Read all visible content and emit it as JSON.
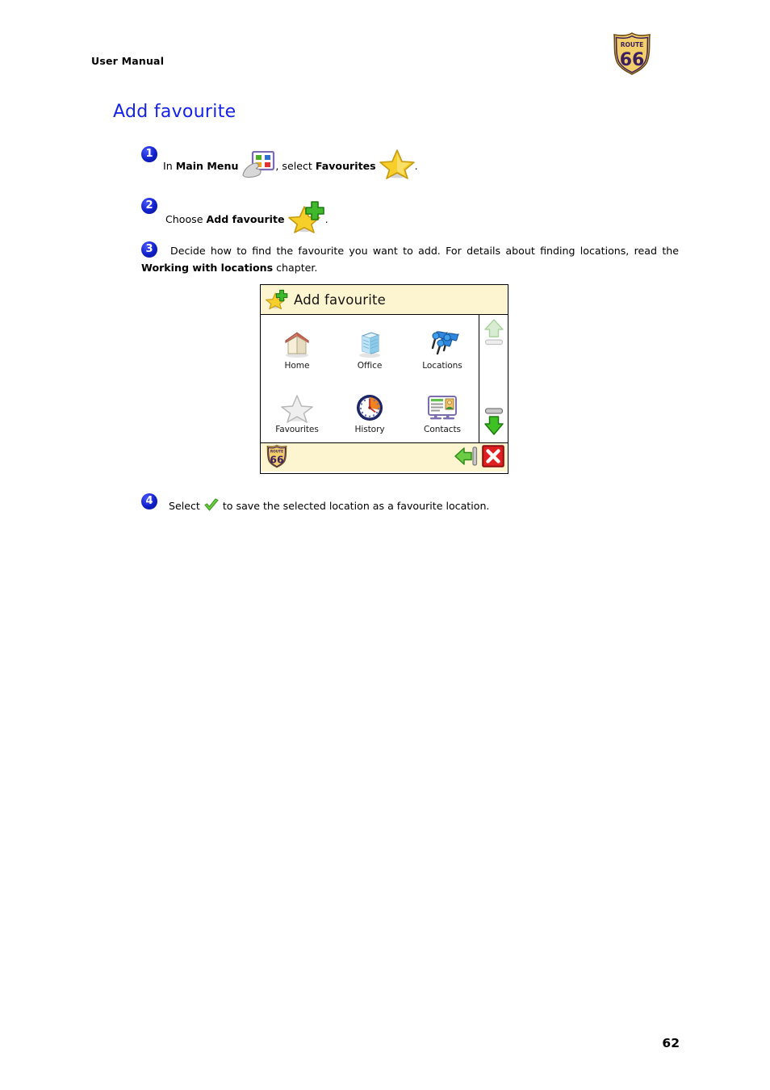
{
  "header": {
    "label": "User Manual",
    "logo": {
      "icon": "route66-shield-icon",
      "top_text": "ROUTE",
      "number": "66",
      "shield_color": "#f2cf6a",
      "text_color": "#3b1f5e"
    }
  },
  "heading": {
    "title": "Add favourite",
    "color": "#1722e8"
  },
  "steps": [
    {
      "number": "1",
      "text_before": "In ",
      "bold1": "Main Menu",
      "icon1": "main-menu-icon",
      "text_middle": ", select ",
      "bold2": "Favourites",
      "icon2": "star-icon",
      "text_after": "."
    },
    {
      "number": "2",
      "text_before": "Choose ",
      "bold1": "Add favourite",
      "icon1": "star-plus-icon",
      "text_after": "."
    },
    {
      "number": "3",
      "text_part1": "Decide how to find the favourite you want to add. For details about finding locations, read the ",
      "bold1": "Working with locations",
      "text_part2": " chapter."
    },
    {
      "number": "4",
      "text_before": "Select ",
      "icon1": "green-check-icon",
      "text_after": " to save the selected location as a favourite location."
    }
  ],
  "device": {
    "title": {
      "icon": "star-plus-icon",
      "text": "Add favourite"
    },
    "titlebar_bg": "#fdf5cf",
    "grid": [
      {
        "label": "Home",
        "icon": "house-icon"
      },
      {
        "label": "Office",
        "icon": "office-building-icon"
      },
      {
        "label": "Locations",
        "icon": "map-pins-icon"
      },
      {
        "label": "Favourites",
        "icon": "grey-star-icon"
      },
      {
        "label": "History",
        "icon": "clock-icon"
      },
      {
        "label": "Contacts",
        "icon": "contact-card-icon"
      }
    ],
    "scroll": {
      "up": {
        "icon": "scroll-up-arrow-icon",
        "state": "disabled"
      },
      "down": {
        "icon": "scroll-down-arrow-icon",
        "state": "enabled"
      }
    },
    "bottom": {
      "logo": {
        "icon": "route66-shield-icon",
        "top_text": "ROUTE",
        "number": "66"
      },
      "back": {
        "icon": "green-back-arrow-icon"
      },
      "close": {
        "icon": "red-close-x-icon"
      }
    }
  },
  "footer": {
    "page_number": "62"
  }
}
